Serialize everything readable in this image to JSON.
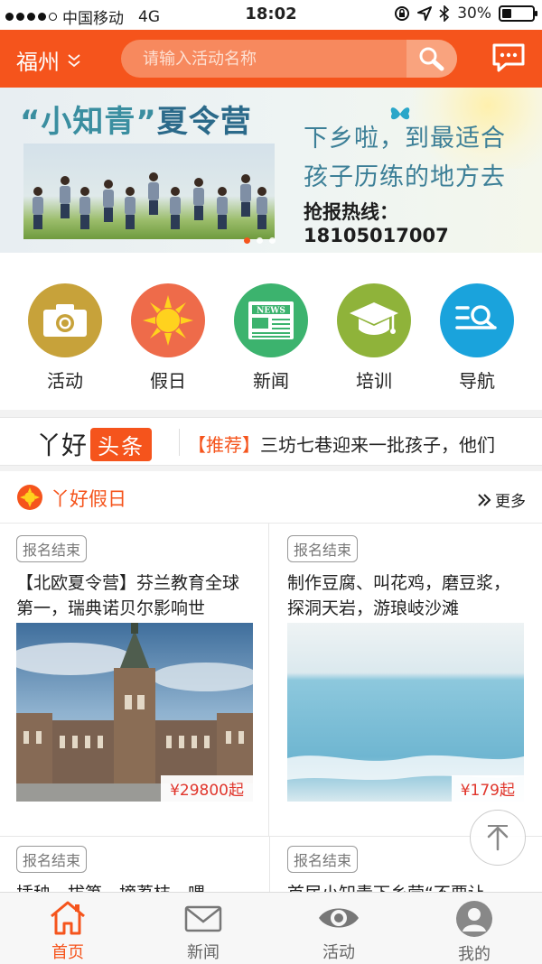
{
  "status_bar": {
    "carrier": "中国移动",
    "network": "4G",
    "time": "18:02",
    "battery": "30%",
    "battery_level": 0.3
  },
  "header": {
    "city": "福州",
    "search_placeholder": "请输入活动名称"
  },
  "banner": {
    "title_part1": "“小知青”",
    "title_part2": "夏令营",
    "line1": "下乡啦，到最适合",
    "line2": "孩子历练的地方去",
    "hotline": "抢报热线：18105017007",
    "slide_count": 3,
    "active_slide": 0
  },
  "categories": [
    {
      "label": "活动",
      "icon": "camera-icon",
      "color": "#c7a23a"
    },
    {
      "label": "假日",
      "icon": "sun-icon",
      "color": "#ee6b4a"
    },
    {
      "label": "新闻",
      "icon": "newspaper-icon",
      "color": "#3cb36e"
    },
    {
      "label": "培训",
      "icon": "graduation-cap-icon",
      "color": "#8fb33a"
    },
    {
      "label": "导航",
      "icon": "navigation-search-icon",
      "color": "#1aa3dc"
    }
  ],
  "headline": {
    "logo_text": "丫好",
    "logo_tag": "头条",
    "tag": "【推荐】",
    "text": "三坊七巷迎来一批孩子，他们"
  },
  "section": {
    "title": "丫好假日",
    "more": "更多"
  },
  "cards": [
    {
      "badge": "报名结束",
      "title": "【北欧夏令营】芬兰教育全球第一，瑞典诺贝尔影响世",
      "price": "¥29800起"
    },
    {
      "badge": "报名结束",
      "title": "制作豆腐、叫花鸡，磨豆浆，探洞天岩，游琅岐沙滩",
      "price": "¥179起"
    }
  ],
  "cards_row2": [
    {
      "badge": "报名结束",
      "title": "插秧、拔笋、摘荔枝、喂"
    },
    {
      "badge": "报名结束",
      "title": "首届小知青下乡营“不要让"
    }
  ],
  "tabbar": [
    {
      "label": "首页",
      "icon": "home-icon",
      "active": true
    },
    {
      "label": "新闻",
      "icon": "envelope-icon",
      "active": false
    },
    {
      "label": "活动",
      "icon": "eye-icon",
      "active": false
    },
    {
      "label": "我的",
      "icon": "user-icon",
      "active": false
    }
  ],
  "colors": {
    "brand": "#f5541c",
    "price": "#e0352b"
  }
}
